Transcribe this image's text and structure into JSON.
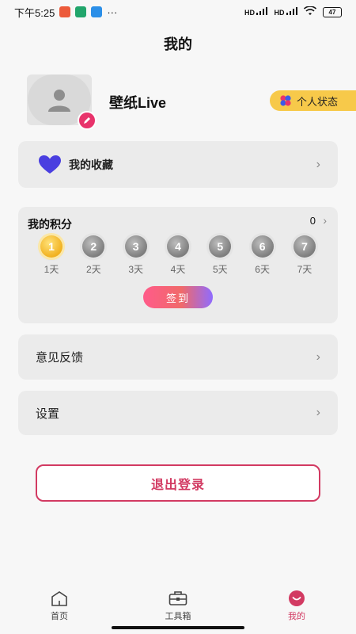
{
  "status_bar": {
    "time": "下午5:25",
    "dots": "···",
    "signal_1": "HD",
    "signal_2": "HD",
    "battery": "47"
  },
  "header": {
    "title": "我的"
  },
  "profile": {
    "username": "壁纸Live",
    "status_chip_label": "个人状态"
  },
  "favorites": {
    "label": "我的收藏",
    "icon": "heart-icon",
    "icon_color": "#4a3fe0"
  },
  "points": {
    "title": "我的积分",
    "value": "0",
    "days": [
      {
        "num": "1",
        "label": "1天",
        "active": true
      },
      {
        "num": "2",
        "label": "2天",
        "active": false
      },
      {
        "num": "3",
        "label": "3天",
        "active": false
      },
      {
        "num": "4",
        "label": "4天",
        "active": false
      },
      {
        "num": "5",
        "label": "5天",
        "active": false
      },
      {
        "num": "6",
        "label": "6天",
        "active": false
      },
      {
        "num": "7",
        "label": "7天",
        "active": false
      }
    ],
    "signin_label": "签到"
  },
  "menu": {
    "feedback_label": "意见反馈",
    "settings_label": "设置"
  },
  "logout_label": "退出登录",
  "tabbar": {
    "home": "首页",
    "tools": "工具箱",
    "mine": "我的"
  },
  "colors": {
    "accent": "#d23a62",
    "chip": "#f7c94a",
    "card": "#ebebeb"
  }
}
